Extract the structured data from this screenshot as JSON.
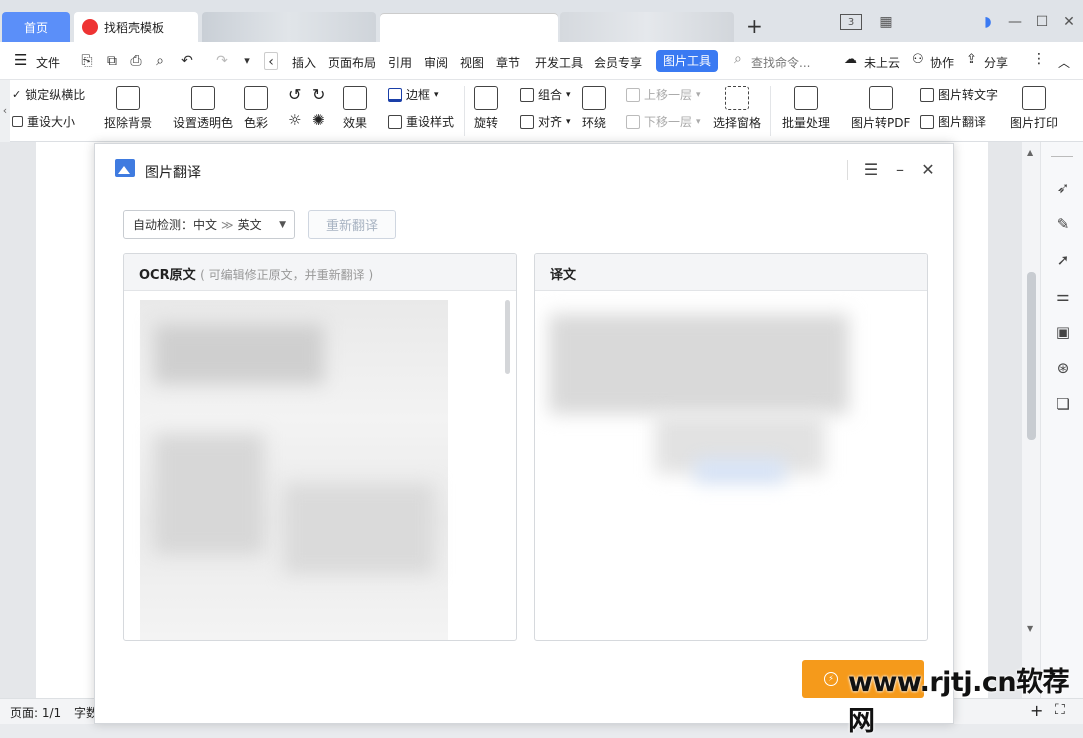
{
  "tabs": {
    "home": "首页",
    "template": "找稻壳模板",
    "new_tab": "+"
  },
  "window": {
    "layout_badge": "3"
  },
  "menu": {
    "file": "文件",
    "items": [
      "插入",
      "页面布局",
      "引用",
      "审阅",
      "视图",
      "章节",
      "开发工具",
      "会员专享"
    ],
    "picture_tool": "图片工具",
    "search_placeholder": "查找命令...",
    "cloud": "未上云",
    "collab": "协作",
    "share": "分享"
  },
  "ribbon": {
    "lock_ratio": "锁定纵横比",
    "reset_size": "重设大小",
    "remove_bg": "抠除背景",
    "set_transparent": "设置透明色",
    "color": "色彩",
    "effects": "效果",
    "border": "边框",
    "reset_style": "重设样式",
    "rotate": "旋转",
    "group": "组合",
    "align": "对齐",
    "wrap": "环绕",
    "bring_forward": "上移一层",
    "send_backward": "下移一层",
    "selection_pane": "选择窗格",
    "batch": "批量处理",
    "to_pdf": "图片转PDF",
    "to_text": "图片转文字",
    "translate": "图片翻译",
    "print": "图片打印"
  },
  "dialog": {
    "title": "图片翻译",
    "lang_detect": "自动检测：中文",
    "lang_arrow": "≫",
    "lang_target": "英文",
    "retranslate": "重新翻译",
    "ocr_title": "OCR原文",
    "ocr_hint": "( 可编辑修正原文，并重新翻译 )",
    "result_title": "译文"
  },
  "status": {
    "page": "页面: 1/1",
    "words": "字数"
  },
  "watermark": "www.rjtj.cn软荐网",
  "colors": {
    "accent": "#3a7af2",
    "home_tab": "#5b8ff9",
    "orange": "#f59a1b"
  }
}
